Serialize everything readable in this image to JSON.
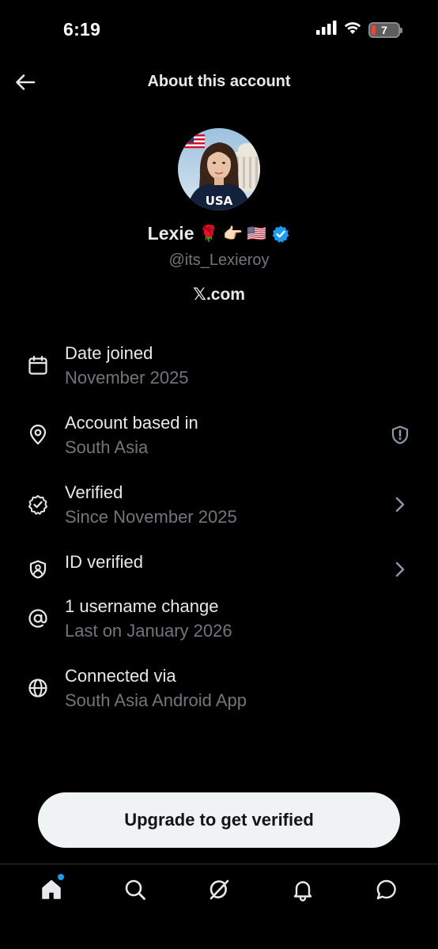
{
  "status_bar": {
    "time": "6:19",
    "battery_level": "7"
  },
  "header": {
    "title": "About this account"
  },
  "profile": {
    "display_name": "Lexie",
    "name_emojis": "🌹 👉🏻 🇺🇸",
    "handle": "@its_Lexieroy",
    "domain": "𝕏.com",
    "verified_badge_color": "#1d9bf0"
  },
  "info": {
    "date_joined": {
      "label": "Date joined",
      "value": "November 2025",
      "icon": "calendar-icon"
    },
    "account_based": {
      "label": "Account based in",
      "value": "South Asia",
      "icon": "location-pin-icon",
      "right_icon": "shield-alert-icon"
    },
    "verified": {
      "label": "Verified",
      "value": "Since November 2025",
      "icon": "verified-badge-icon",
      "right_icon": "chevron-right-icon"
    },
    "id_verified": {
      "label": "ID verified",
      "icon": "id-shield-icon",
      "right_icon": "chevron-right-icon"
    },
    "username_change": {
      "label": "1 username change",
      "value": "Last on January 2026",
      "icon": "at-sign-icon"
    },
    "connected_via": {
      "label": "Connected via",
      "value": "South Asia Android App",
      "icon": "globe-icon"
    }
  },
  "actions": {
    "upgrade_label": "Upgrade to get verified"
  },
  "nav": {
    "items": [
      "home-icon",
      "search-icon",
      "grok-icon",
      "notifications-icon",
      "messages-icon"
    ],
    "active": "home-icon"
  },
  "colors": {
    "background": "#000000",
    "text_primary": "#e7e9ea",
    "text_secondary": "#71767b",
    "accent": "#1d9bf0",
    "button_bg": "#eff3f4"
  }
}
